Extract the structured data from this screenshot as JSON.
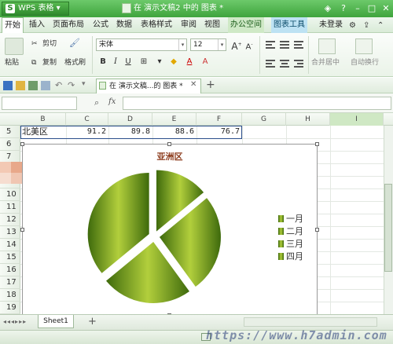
{
  "app": {
    "name": "WPS 表格",
    "doc_title": "在 演示文稿2 中的 图表 *"
  },
  "menu": {
    "items": [
      "开始",
      "插入",
      "页面布局",
      "公式",
      "数据",
      "表格样式",
      "审阅",
      "视图"
    ],
    "office_space": "办公空间",
    "chart_tools": "图表工具",
    "login": "未登录"
  },
  "ribbon": {
    "paste": "粘贴",
    "cut": "剪切",
    "copy": "复制",
    "format_painter": "格式刷",
    "font_name": "宋体",
    "font_size": "12",
    "merge_center": "合并居中",
    "wrap_text": "自动换行"
  },
  "doc_tab": "在 演示文稿...的 图表 *",
  "formula_bar": {
    "fx": "fx",
    "value": ""
  },
  "columns": [
    "B",
    "C",
    "D",
    "E",
    "F",
    "G",
    "H",
    "I"
  ],
  "rows": [
    "5",
    "6",
    "7",
    "8",
    "9",
    "10",
    "11",
    "12",
    "13",
    "14",
    "15",
    "16",
    "17",
    "18",
    "19"
  ],
  "row5": {
    "region": "北美区",
    "values": [
      "91.2",
      "89.8",
      "88.6",
      "76.7"
    ]
  },
  "chart": {
    "title": "亚洲区",
    "legend": [
      "一月",
      "二月",
      "三月",
      "四月"
    ],
    "colors": {
      "dark": "#3e6a0c",
      "light": "#b2cf3c"
    }
  },
  "chart_data": {
    "type": "pie",
    "title": "亚洲区",
    "categories": [
      "一月",
      "二月",
      "三月",
      "四月"
    ],
    "values": [
      14,
      26,
      24,
      36
    ],
    "legend": "right"
  },
  "sheet": {
    "tab": "Sheet1",
    "add": "+"
  },
  "watermark": "https://www.h7admin.com"
}
